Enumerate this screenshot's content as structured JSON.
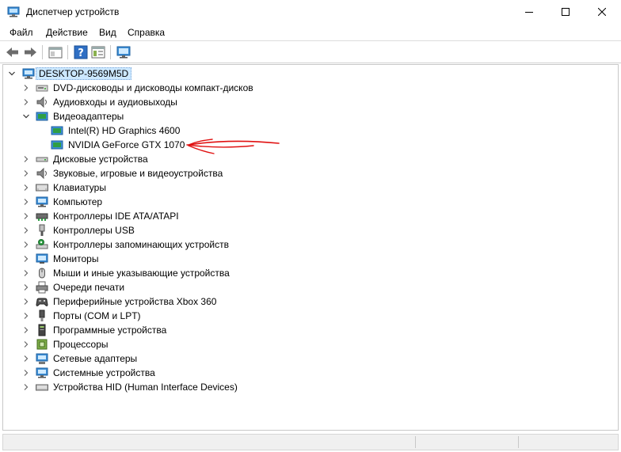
{
  "window": {
    "title": "Диспетчер устройств",
    "buttons": {
      "minimize": "minimize-icon",
      "maximize": "maximize-icon",
      "close": "close-icon"
    }
  },
  "menu": {
    "items": [
      "Файл",
      "Действие",
      "Вид",
      "Справка"
    ]
  },
  "toolbar": {
    "buttons": [
      "back-arrow-icon",
      "forward-arrow-icon",
      "show-hide-console-tree-icon",
      "help-icon",
      "properties-icon",
      "monitor-scan-icon"
    ]
  },
  "tree": {
    "root": {
      "label": "DESKTOP-9569M5D",
      "expanded": true,
      "selected": true
    },
    "categories": [
      {
        "label": "DVD-дисководы и дисководы компакт-дисков",
        "icon": "dvd-drive-icon",
        "expanded": false
      },
      {
        "label": "Аудиовходы и аудиовыходы",
        "icon": "speaker-icon",
        "expanded": false
      },
      {
        "label": "Видеоадаптеры",
        "icon": "display-adapter-icon",
        "expanded": true,
        "children": [
          {
            "label": "Intel(R) HD Graphics 4600",
            "icon": "display-adapter-icon"
          },
          {
            "label": "NVIDIA GeForce GTX 1070",
            "icon": "display-adapter-icon"
          }
        ]
      },
      {
        "label": "Дисковые устройства",
        "icon": "disk-drive-icon",
        "expanded": false
      },
      {
        "label": "Звуковые, игровые и видеоустройства",
        "icon": "sound-icon",
        "expanded": false
      },
      {
        "label": "Клавиатуры",
        "icon": "keyboard-icon",
        "expanded": false
      },
      {
        "label": "Компьютер",
        "icon": "computer-icon",
        "expanded": false
      },
      {
        "label": "Контроллеры IDE ATA/ATAPI",
        "icon": "ide-controller-icon",
        "expanded": false
      },
      {
        "label": "Контроллеры USB",
        "icon": "usb-icon",
        "expanded": false
      },
      {
        "label": "Контроллеры запоминающих устройств",
        "icon": "storage-controller-icon",
        "expanded": false
      },
      {
        "label": "Мониторы",
        "icon": "monitor-icon",
        "expanded": false
      },
      {
        "label": "Мыши и иные указывающие устройства",
        "icon": "mouse-icon",
        "expanded": false
      },
      {
        "label": "Очереди печати",
        "icon": "printer-icon",
        "expanded": false
      },
      {
        "label": "Периферийные устройства Xbox 360",
        "icon": "gamepad-icon",
        "expanded": false
      },
      {
        "label": "Порты (COM и LPT)",
        "icon": "port-icon",
        "expanded": false
      },
      {
        "label": "Программные устройства",
        "icon": "software-device-icon",
        "expanded": false
      },
      {
        "label": "Процессоры",
        "icon": "processor-icon",
        "expanded": false
      },
      {
        "label": "Сетевые адаптеры",
        "icon": "network-adapter-icon",
        "expanded": false
      },
      {
        "label": "Системные устройства",
        "icon": "system-device-icon",
        "expanded": false
      },
      {
        "label": "Устройства HID (Human Interface Devices)",
        "icon": "hid-icon",
        "expanded": false
      }
    ]
  },
  "annotation": {
    "icon": "red-hand-drawn-arrow-icon",
    "color": "#e01010"
  },
  "colors": {
    "selection": "#cce8ff",
    "adapter_icon": "#2f9e44",
    "monitor_blue": "#3d8fd6"
  }
}
